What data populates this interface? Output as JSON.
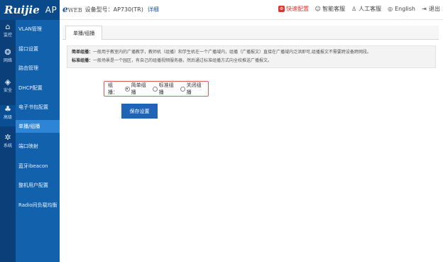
{
  "header": {
    "brand": "Ruijie",
    "model": "AP",
    "eweb_logo": "e",
    "eweb_text": "WEB",
    "device_label": "设备型号：AP730(TR)",
    "detail_link": "详细",
    "links": {
      "quick_config": "快速配置",
      "smart_service": "智能客服",
      "human_service": "人工客服",
      "language": "English",
      "logout": "退出"
    }
  },
  "sidebar": {
    "sections": [
      {
        "label": "监控",
        "icon": "home-icon"
      },
      {
        "label": "网络",
        "icon": "globe-icon"
      },
      {
        "label": "安全",
        "icon": "shield-icon"
      },
      {
        "label": "高级",
        "icon": "users-icon"
      },
      {
        "label": "系统",
        "icon": "gear-icon"
      }
    ],
    "items": [
      {
        "label": "VLAN管理"
      },
      {
        "label": "接口设置"
      },
      {
        "label": "路由管理"
      },
      {
        "label": "DHCP配置"
      },
      {
        "label": "电子书包配置"
      },
      {
        "label": "单播/组播"
      },
      {
        "label": "端口映射"
      },
      {
        "label": "蓝牙ibeacon"
      },
      {
        "label": "整机用户配置"
      },
      {
        "label": "Radio间负载均衡"
      }
    ],
    "active_item": "单播/组播"
  },
  "main": {
    "tab": "单播/组播",
    "info": {
      "simple_title": "简单组播：",
      "simple_desc": "一般用于教室内的广播教学，教师机（组播）和学生机在一个广播域内，组播（广播报文）直接在广播域内泛洪即可,组播报文不需要跨设备跨网段。",
      "standard_title": "标准组播：",
      "standard_desc": "一般场景是一个园区，有自己的组播视频服务器，然后通过标准组播方式向全校推送广播报文。"
    },
    "mode_label": "组播：",
    "options": [
      "简单组播",
      "标准组播",
      "关闭组播"
    ],
    "selected": "简单组播",
    "save_button": "保存设置"
  },
  "colors": {
    "sidebar_dark": "#0a3f7a",
    "submenu": "#1161ad",
    "submenu_active": "#2e85d6",
    "primary_button": "#1f64b7",
    "highlight_red": "#e15a5a",
    "quick_config_red": "#d9362f"
  }
}
